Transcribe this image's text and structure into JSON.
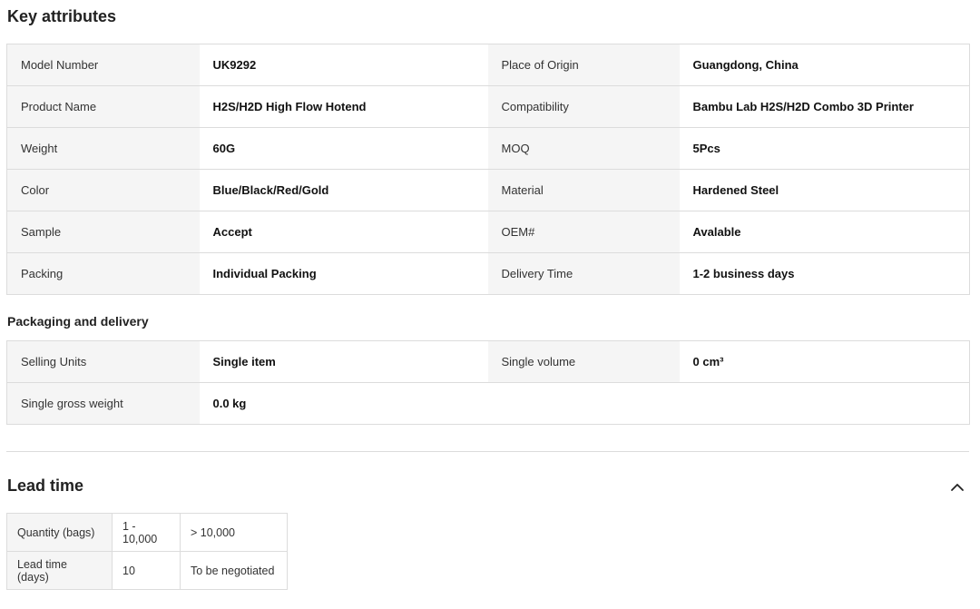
{
  "key_attributes": {
    "title": "Key attributes",
    "rows": [
      [
        {
          "label": "Model Number",
          "value": "UK9292"
        },
        {
          "label": "Place of Origin",
          "value": "Guangdong, China"
        }
      ],
      [
        {
          "label": "Product Name",
          "value": "H2S/H2D High Flow Hotend"
        },
        {
          "label": "Compatibility",
          "value": "Bambu Lab H2S/H2D Combo 3D Printer"
        }
      ],
      [
        {
          "label": "Weight",
          "value": "60G"
        },
        {
          "label": "MOQ",
          "value": "5Pcs"
        }
      ],
      [
        {
          "label": "Color",
          "value": "Blue/Black/Red/Gold"
        },
        {
          "label": "Material",
          "value": "Hardened Steel"
        }
      ],
      [
        {
          "label": "Sample",
          "value": "Accept"
        },
        {
          "label": "OEM#",
          "value": "Avalable"
        }
      ],
      [
        {
          "label": "Packing",
          "value": "Individual Packing"
        },
        {
          "label": "Delivery Time",
          "value": "1-2 business days"
        }
      ]
    ]
  },
  "packaging": {
    "title": "Packaging and delivery",
    "rows": [
      [
        {
          "label": "Selling Units",
          "value": "Single item"
        },
        {
          "label": "Single volume",
          "value": "0 cm³"
        }
      ],
      [
        {
          "label": "Single gross weight",
          "value": "0.0 kg"
        }
      ]
    ]
  },
  "lead_time": {
    "title": "Lead time",
    "collapse_icon": "chevron-up-icon",
    "header": [
      "Quantity (bags)",
      "1 - 10,000",
      "> 10,000"
    ],
    "row": [
      "Lead time (days)",
      "10",
      "To be negotiated"
    ]
  }
}
